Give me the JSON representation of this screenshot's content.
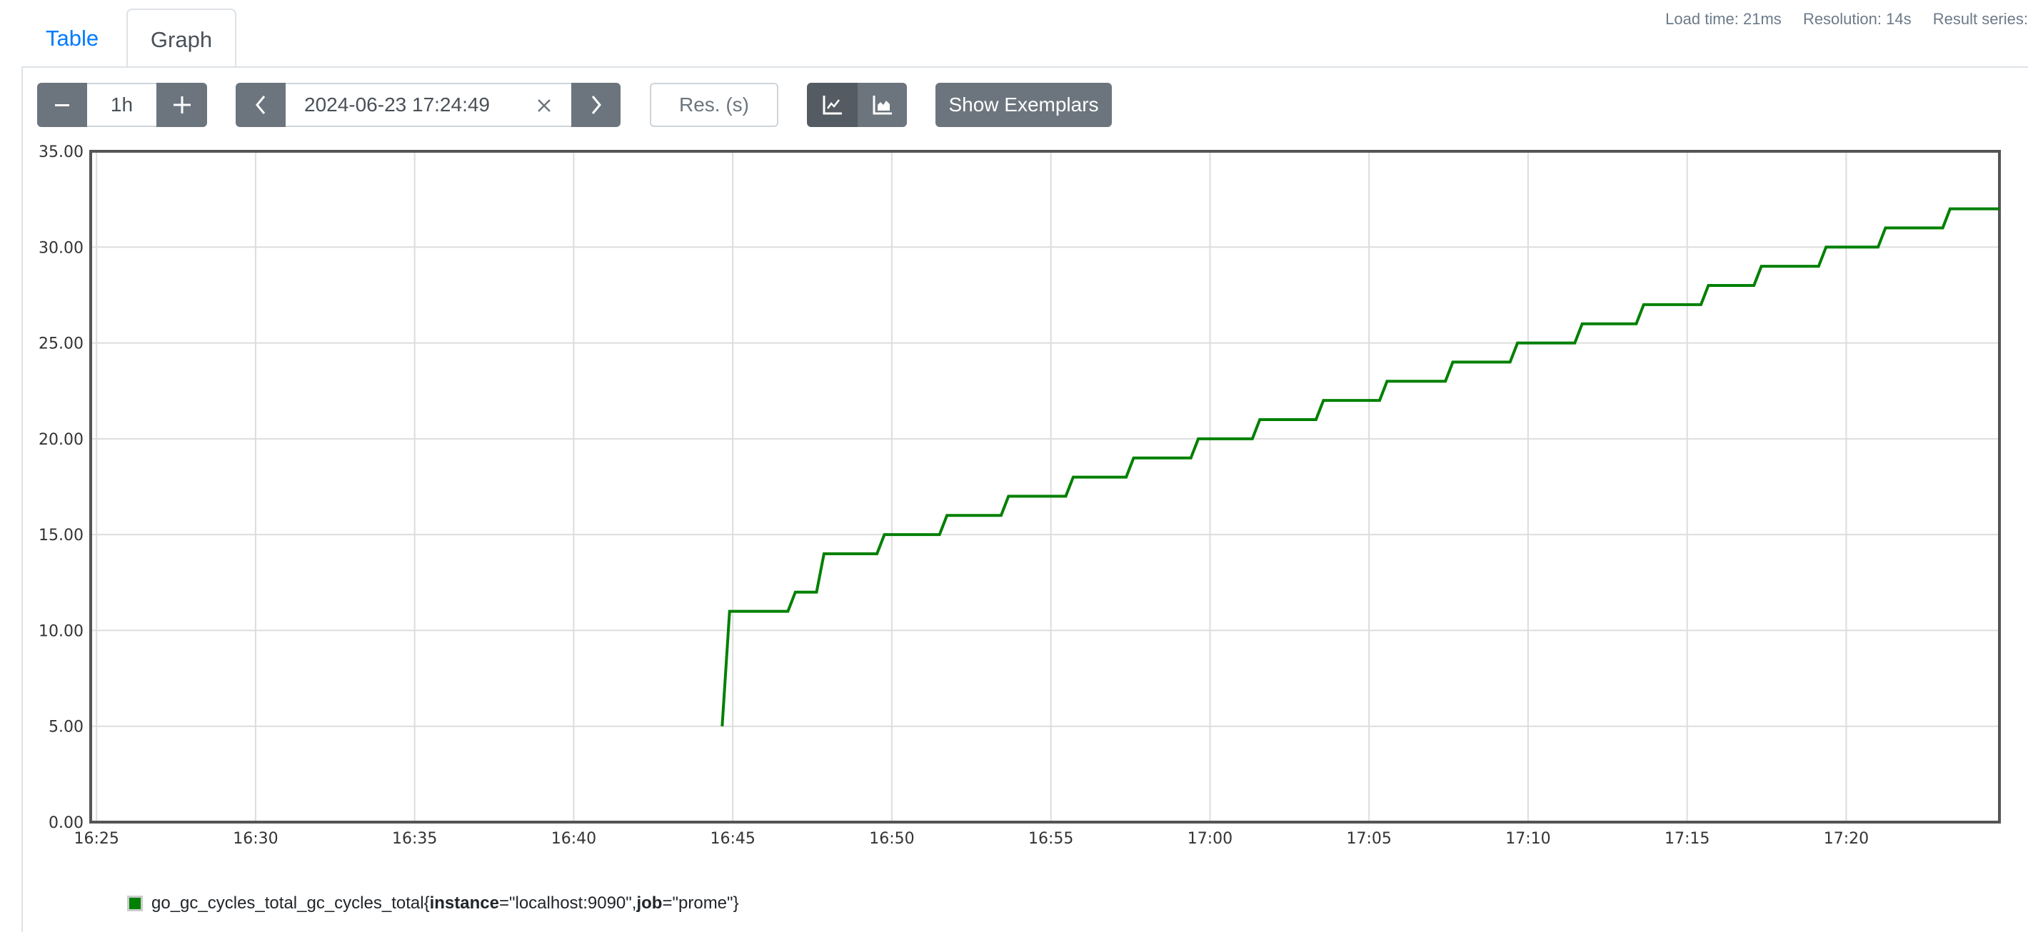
{
  "tabs": [
    {
      "label": "Table",
      "active": false
    },
    {
      "label": "Graph",
      "active": true
    }
  ],
  "stats": {
    "load_time": "Load time: 21ms",
    "resolution": "Resolution: 14s",
    "result_series": "Result series:"
  },
  "controls": {
    "range_minus_icon": "minus-icon",
    "range_value": "1h",
    "range_plus_icon": "plus-icon",
    "prev_icon": "chevron-left-icon",
    "end_time": "2024-06-23 17:24:49",
    "clear_icon": "close-icon",
    "next_icon": "chevron-right-icon",
    "resolution_placeholder": "Res. (s)",
    "chart_type_line_icon": "line-chart-icon",
    "chart_type_stacked_icon": "area-chart-icon",
    "show_exemplars_label": "Show Exemplars"
  },
  "colors": {
    "series": "#008000",
    "button": "#6c757d",
    "button_active": "#545b62",
    "link": "#007bff"
  },
  "chart_data": {
    "type": "line",
    "title": "",
    "xlabel": "",
    "ylabel": "",
    "ylim": [
      0,
      35
    ],
    "yticks": [
      "0.00",
      "5.00",
      "10.00",
      "15.00",
      "20.00",
      "25.00",
      "30.00",
      "35.00"
    ],
    "xlim": [
      "16:24:49",
      "17:24:49"
    ],
    "xticks": [
      "16:25",
      "16:30",
      "16:35",
      "16:40",
      "16:45",
      "16:50",
      "16:55",
      "17:00",
      "17:05",
      "17:10",
      "17:15",
      "17:20"
    ],
    "grid": true,
    "legend_position": "bottom-left",
    "series": [
      {
        "name": "go_gc_cycles_total_gc_cycles_total",
        "labels": [
          {
            "key": "instance",
            "value": "localhost:9090"
          },
          {
            "key": "job",
            "value": "prome"
          }
        ],
        "color": "#008000",
        "x": [
          "16:44:40",
          "16:44:54",
          "16:46:44",
          "16:46:58",
          "16:47:38",
          "16:47:52",
          "16:49:32",
          "16:49:46",
          "16:51:30",
          "16:51:44",
          "16:53:26",
          "16:53:40",
          "16:55:28",
          "16:55:42",
          "16:57:22",
          "16:57:36",
          "16:59:24",
          "16:59:38",
          "17:01:20",
          "17:01:34",
          "17:03:20",
          "17:03:34",
          "17:05:20",
          "17:05:34",
          "17:07:24",
          "17:07:38",
          "17:09:26",
          "17:09:40",
          "17:11:28",
          "17:11:42",
          "17:13:24",
          "17:13:38",
          "17:15:26",
          "17:15:40",
          "17:17:06",
          "17:17:20",
          "17:19:08",
          "17:19:22",
          "17:21:00",
          "17:21:14",
          "17:23:02",
          "17:23:16",
          "17:24:49"
        ],
        "values": [
          5,
          11,
          11,
          12,
          12,
          14,
          14,
          15,
          15,
          16,
          16,
          17,
          17,
          18,
          18,
          19,
          19,
          20,
          20,
          21,
          21,
          22,
          22,
          23,
          23,
          24,
          24,
          25,
          25,
          26,
          26,
          27,
          27,
          28,
          28,
          29,
          29,
          30,
          30,
          31,
          31,
          32,
          32
        ]
      }
    ]
  },
  "legend": {
    "metric": "go_gc_cycles_total_gc_cycles_total",
    "open": "{",
    "label1_key": "instance",
    "label1_eq": "=\"localhost:9090\", ",
    "label2_key": "job",
    "label2_eq": "=\"prome\"",
    "close": "}"
  }
}
